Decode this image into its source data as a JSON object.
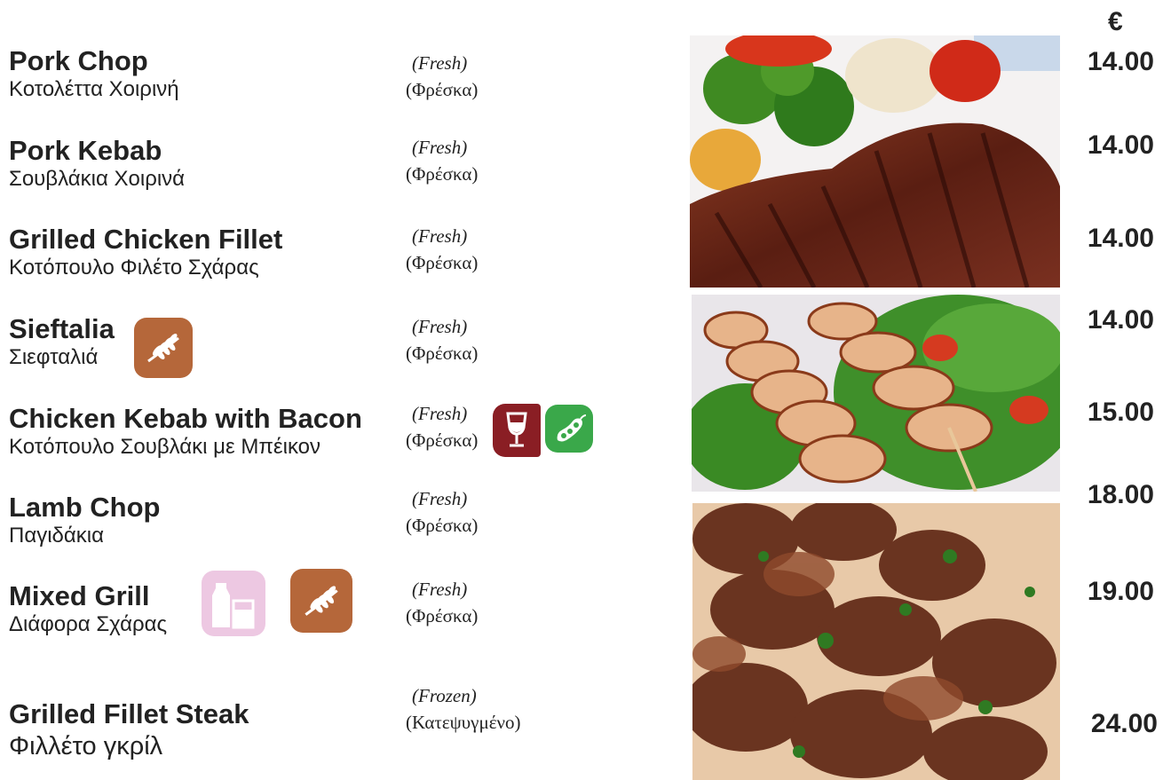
{
  "currency": "€",
  "items": [
    {
      "name_en": "Pork Chop",
      "name_gr": "Κοτολέττα Χοιρινή",
      "status_en": "(Fresh)",
      "status_gr": "(Φρέσκα)",
      "price": "14.00"
    },
    {
      "name_en": "Pork Kebab",
      "name_gr": "Σουβλάκια Χοιρινά",
      "status_en": "(Fresh)",
      "status_gr": "(Φρέσκα)",
      "price": "14.00"
    },
    {
      "name_en": "Grilled Chicken Fillet",
      "name_gr": "Κοτόπουλο Φιλέτο Σχάρας",
      "status_en": "(Fresh)",
      "status_gr": "(Φρέσκα)",
      "price": "14.00"
    },
    {
      "name_en": "Sieftalia",
      "name_gr": "Σιεφταλιά",
      "status_en": "(Fresh)",
      "status_gr": "(Φρέσκα)",
      "price": "14.00",
      "allergens": [
        "cereals-icon"
      ]
    },
    {
      "name_en": "Chicken Kebab with Bacon",
      "name_gr": "Κοτόπουλο Σουβλάκι με Μπέικον",
      "status_en": "(Fresh)",
      "status_gr": "(Φρέσκα)",
      "price": "15.00",
      "allergens": [
        "sulphites-wine-icon",
        "soya-icon"
      ]
    },
    {
      "name_en": "Lamb Chop",
      "name_gr": "Παγιδάκια",
      "status_en": "(Fresh)",
      "status_gr": "(Φρέσκα)",
      "price": "18.00"
    },
    {
      "name_en": "Mixed Grill",
      "name_gr": "Διάφορα Σχάρας",
      "status_en": "(Fresh)",
      "status_gr": "(Φρέσκα)",
      "price": "19.00",
      "allergens": [
        "milk-icon",
        "cereals-icon"
      ]
    },
    {
      "name_en": "Grilled Fillet Steak",
      "name_gr": "Φιλλέτο γκρίλ",
      "status_en": "(Frozen)",
      "status_gr": "(Κατεψυγμένο)",
      "price": "24.00"
    }
  ],
  "colors": {
    "cereals": "#b5673a",
    "wine": "#8a1e24",
    "soya": "#3aa84a",
    "milk": "#edc8e2"
  }
}
